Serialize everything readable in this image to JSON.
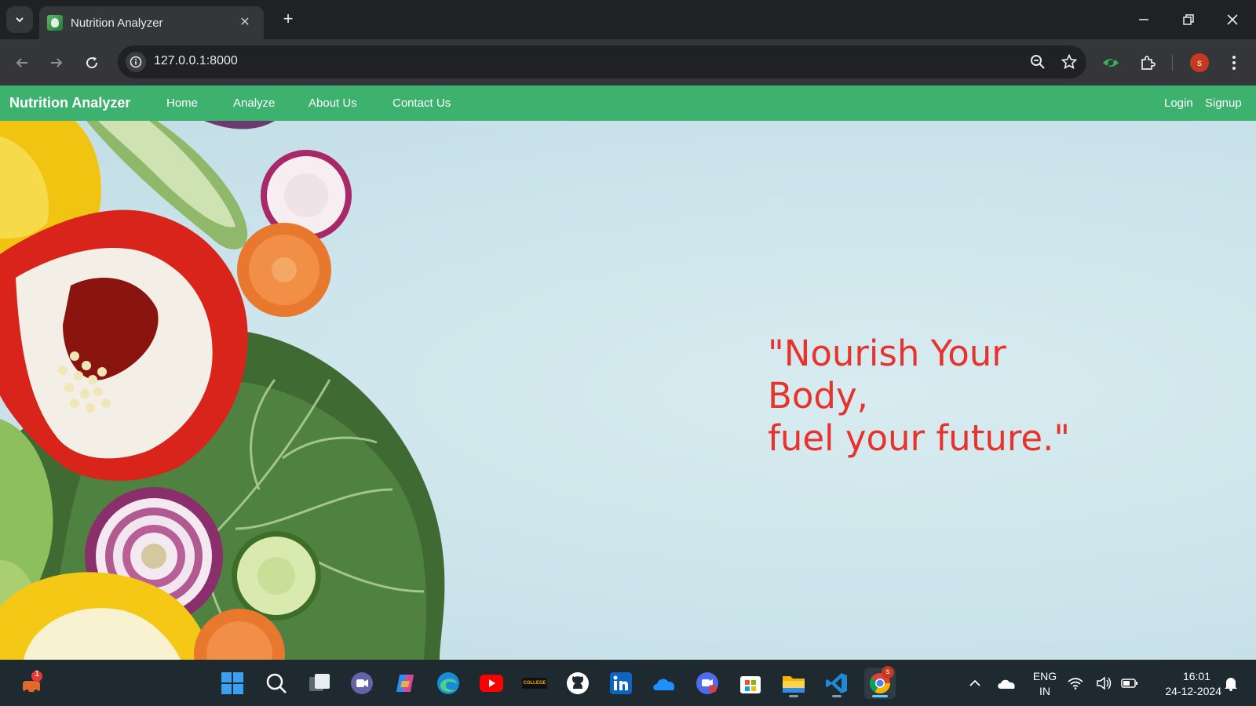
{
  "browser": {
    "tab_title": "Nutrition Analyzer",
    "url": "127.0.0.1:8000",
    "profile_initial": "s"
  },
  "site": {
    "brand": "Nutrition Analyzer",
    "nav_links": [
      "Home",
      "Analyze",
      "About Us",
      "Contact Us"
    ],
    "auth_links": [
      "Login",
      "Signup"
    ],
    "quote_line1": "\"Nourish Your Body,",
    "quote_line2": "fuel your future.\"",
    "colors": {
      "navbar": "#3db26f",
      "quote": "#e8322c",
      "background": "#cfe6ec"
    }
  },
  "taskbar": {
    "widget_badge": "1",
    "chrome_badge": "s",
    "college_label": "COLLEGE",
    "language": "ENG",
    "region": "IN",
    "time": "16:01",
    "date": "24-12-2024",
    "apps": [
      "start-icon",
      "search-icon",
      "task-view-icon",
      "teams-icon",
      "copilot-icon",
      "edge-icon",
      "youtube-icon",
      "college-icon",
      "github-icon",
      "linkedin-icon",
      "onedrive-icon",
      "meet-icon",
      "store-icon",
      "file-explorer-icon",
      "vscode-icon",
      "chrome-icon"
    ]
  }
}
